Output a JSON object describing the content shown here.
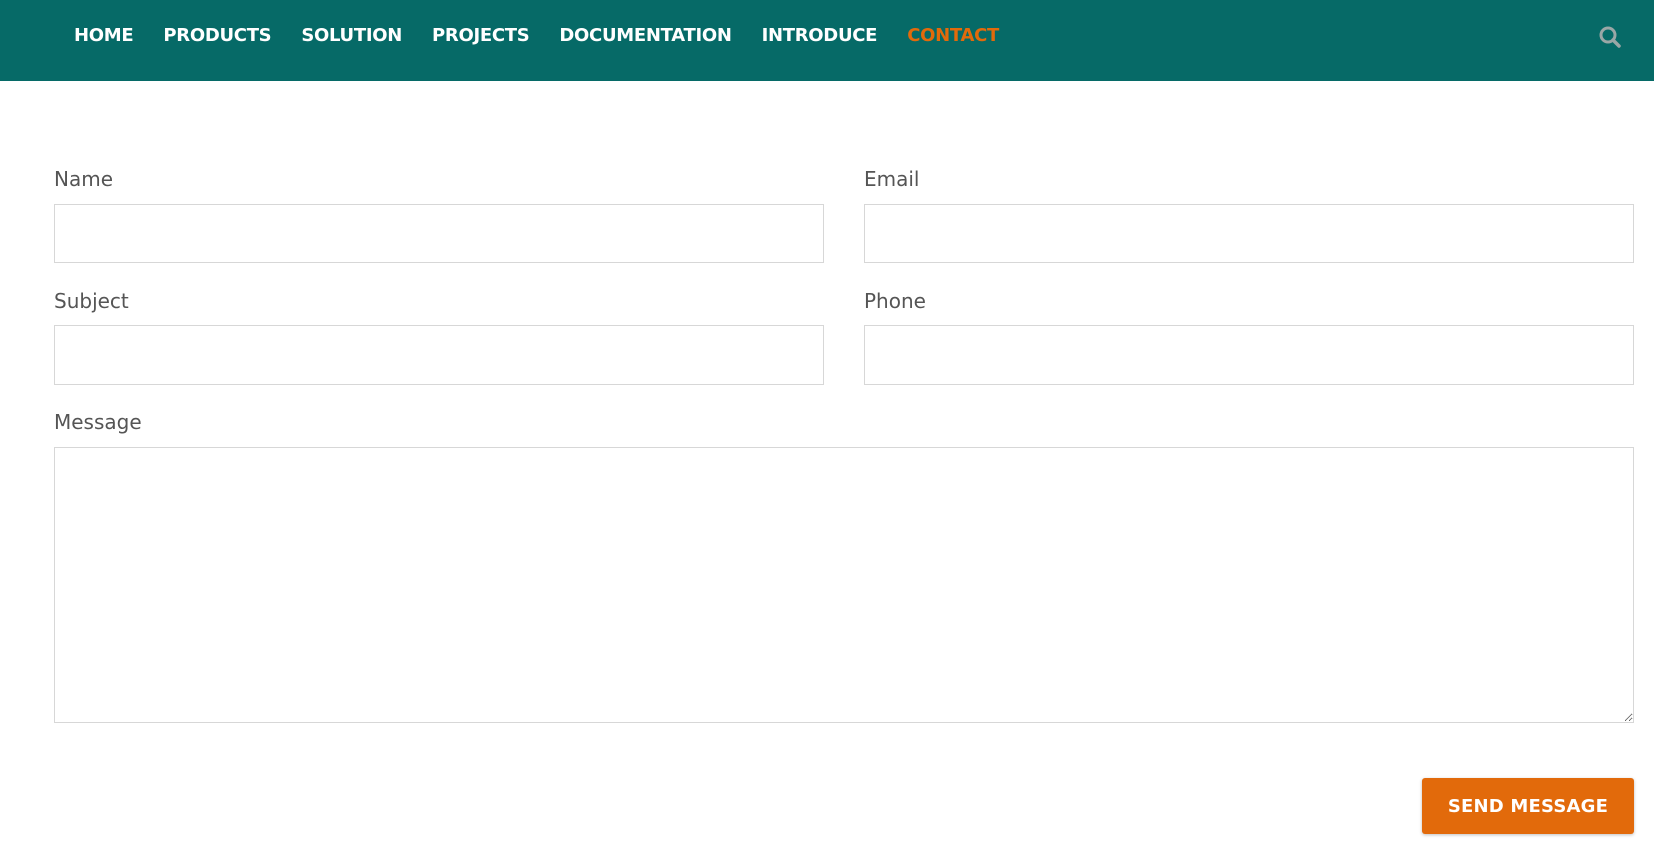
{
  "nav": {
    "items": [
      {
        "label": "HOME"
      },
      {
        "label": "PRODUCTS"
      },
      {
        "label": "SOLUTION"
      },
      {
        "label": "PROJECTS"
      },
      {
        "label": "DOCUMENTATION"
      },
      {
        "label": "INTRODUCE"
      },
      {
        "label": "CONTACT"
      }
    ],
    "active": "CONTACT",
    "search_icon": "search-icon"
  },
  "form": {
    "name_label": "Name",
    "email_label": "Email",
    "subject_label": "Subject",
    "phone_label": "Phone",
    "message_label": "Message",
    "name_value": "",
    "email_value": "",
    "subject_value": "",
    "phone_value": "",
    "message_value": "",
    "submit_label": "SEND MESSAGE"
  },
  "colors": {
    "header_bg": "#066a67",
    "accent": "#e26a0b",
    "label_text": "#555555",
    "field_border": "#d7d7d7"
  }
}
